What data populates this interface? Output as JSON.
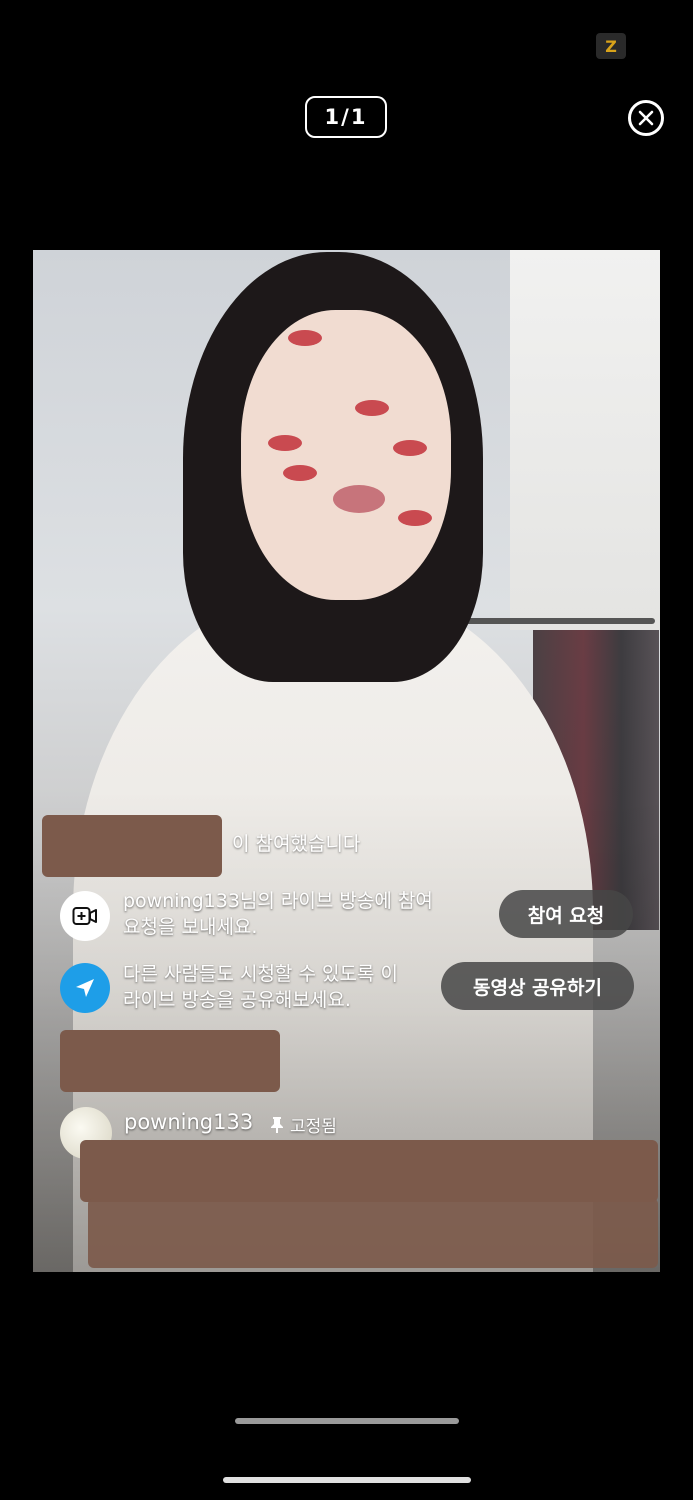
{
  "header": {
    "counter": "1/1",
    "logo_text": "Z"
  },
  "live": {
    "joined_suffix": "이 참여했습니다",
    "request_row": {
      "text_line1": "powning133님의 라이브 방송에 참여",
      "text_line2": "요청을 보내세요.",
      "button_label": "참여 요청"
    },
    "share_row": {
      "text_line1": "다른 사람들도 시청할 수 있도록 이",
      "text_line2": "라이브 방송을 공유해보세요.",
      "button_label": "동영상 공유하기"
    },
    "pinned_comment": {
      "username": "powning133",
      "pinned_label": "고정됨"
    }
  },
  "colors": {
    "background": "#000000",
    "share_icon_bg": "#1e9ee8",
    "request_icon_bg": "#ffffff",
    "redaction": "#7c5a4b"
  },
  "icons": {
    "close": "close-circle-icon",
    "request": "video-add-icon",
    "share": "send-icon",
    "pin": "pin-icon"
  }
}
